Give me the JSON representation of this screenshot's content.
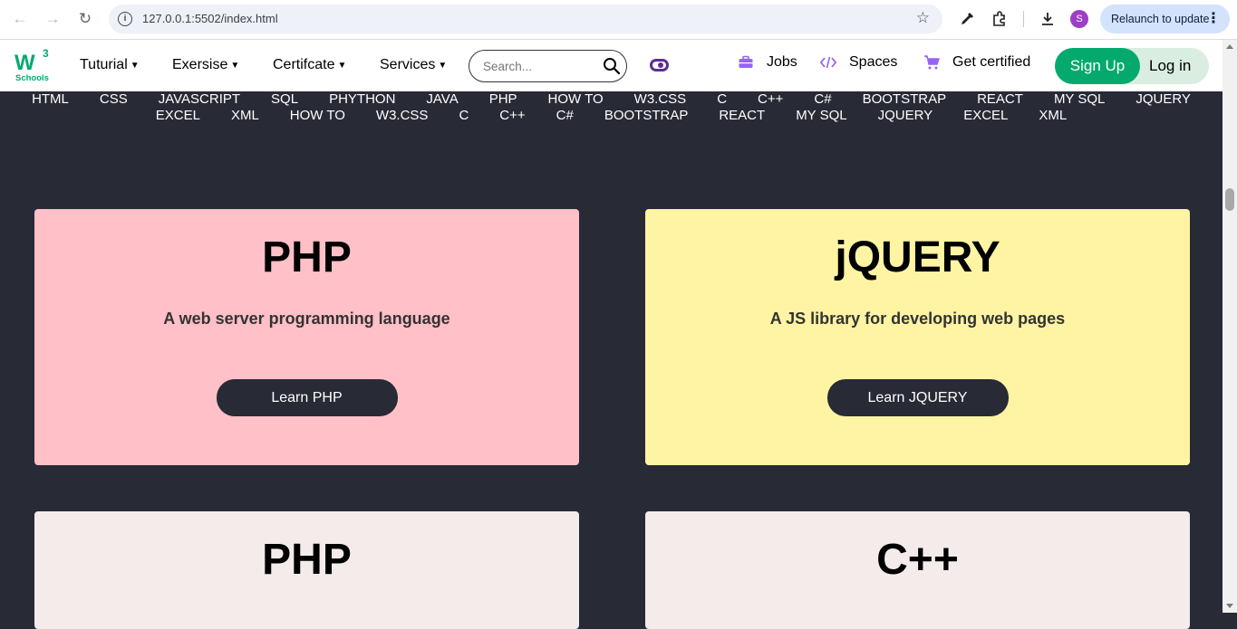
{
  "browser": {
    "url": "127.0.0.1:5502/index.html",
    "profile_initial": "S",
    "relaunch_label": "Relaunch to update"
  },
  "logo": {
    "mark": "W",
    "sup": "3",
    "sub": "Schools"
  },
  "menu": [
    {
      "label": "Tuturial"
    },
    {
      "label": "Exersise"
    },
    {
      "label": "Certifcate"
    },
    {
      "label": "Services"
    }
  ],
  "search": {
    "placeholder": "Search..."
  },
  "links": {
    "jobs": "Jobs",
    "spaces": "Spaces",
    "certified": "Get certified"
  },
  "auth": {
    "signup": "Sign Up",
    "login": "Log in"
  },
  "subjects": {
    "row1": [
      "HTML",
      "CSS",
      "JAVASCRIPT",
      "SQL",
      "PHYTHON",
      "JAVA",
      "PHP",
      "HOW TO",
      "W3.CSS",
      "C",
      "C++",
      "C#",
      "BOOTSTRAP",
      "REACT",
      "MY SQL",
      "JQUERY"
    ],
    "row2": [
      "EXCEL",
      "XML",
      "HOW TO",
      "W3.CSS",
      "C",
      "C++",
      "C#",
      "BOOTSTRAP",
      "REACT",
      "MY SQL",
      "JQUERY",
      "EXCEL",
      "XML"
    ]
  },
  "cards": [
    {
      "title": "PHP",
      "desc": "A web server programming language",
      "button": "Learn PHP",
      "color": "#ffc0c7"
    },
    {
      "title": "jQUERY",
      "desc": "A JS library for developing web pages",
      "button": "Learn JQUERY",
      "color": "#fff4a3"
    },
    {
      "title": "PHP",
      "desc": "",
      "button": "",
      "color": "#f3ecea"
    },
    {
      "title": "C++",
      "desc": "",
      "button": "",
      "color": "#f3ecea"
    }
  ],
  "colors": {
    "page_bg": "#282a35",
    "brand_green": "#04aa6d",
    "login_bg": "#d9eee1"
  }
}
